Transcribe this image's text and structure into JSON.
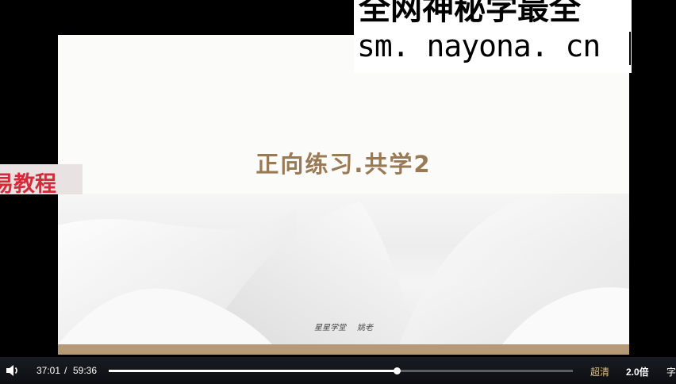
{
  "slide": {
    "title": "正向练习.共学2",
    "footer_brand": "星星学堂",
    "footer_author": "姚老"
  },
  "watermark": {
    "line1": "全网神秘学最全",
    "line2": "sm. nayona. cn"
  },
  "promo": {
    "text": "易教程"
  },
  "player": {
    "current_time": "37:01",
    "separator": "/",
    "total_time": "59:36",
    "progress": 0.621,
    "quality": "超清",
    "speed": "2.0倍",
    "subtitle": "字"
  },
  "colors": {
    "title": "#9a7a55",
    "slide_bar": "#b69a78",
    "promo_text": "#d62a3a",
    "quality": "#e5c07b"
  },
  "icons": {
    "volume": "volume-icon"
  }
}
